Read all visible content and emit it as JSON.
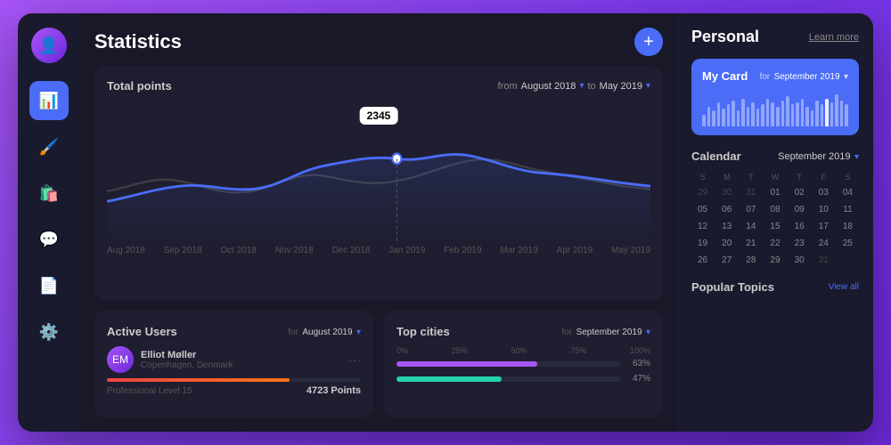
{
  "sidebar": {
    "icons": [
      "📊",
      "🖌️",
      "🛍️",
      "💬",
      "📄",
      "⚙️"
    ]
  },
  "header": {
    "title": "Statistics",
    "add_btn": "+"
  },
  "chart": {
    "title": "Total points",
    "from_label": "from",
    "from_value": "August 2018",
    "to_label": "to",
    "to_value": "May 2019",
    "tooltip_value": "2345",
    "x_labels": [
      "Aug 2018",
      "Sep 2018",
      "Oct 2018",
      "Nov 2018",
      "Dec 2018",
      "Jan 2019",
      "Feb 2019",
      "Mar 2019",
      "Apr 2019",
      "May 2019"
    ]
  },
  "active_users": {
    "title": "Active Users",
    "for_label": "for",
    "for_value": "August 2019",
    "user_name": "Elliot Møller",
    "user_location": "Copenhagen, Denmark",
    "progress_label": "Professional Level 15",
    "progress_points": "4723 Points",
    "progress_percent": 72
  },
  "top_cities": {
    "title": "Top cities",
    "for_label": "for",
    "for_value": "September 2019",
    "x_labels": [
      "0%",
      "25%",
      "50%",
      "75%",
      "100%"
    ],
    "bars": [
      {
        "color": "#a855f7",
        "percent": 63,
        "label": "63%"
      },
      {
        "color": "#22d3a7",
        "percent": 47,
        "label": "47%"
      }
    ]
  },
  "right_panel": {
    "title": "Personal",
    "learn_more": "Learn more",
    "my_card": {
      "title": "My Card",
      "for_label": "for",
      "for_value": "September 2019",
      "bar_heights": [
        30,
        50,
        40,
        60,
        45,
        55,
        65,
        40,
        70,
        50,
        60,
        45,
        55,
        70,
        60,
        50,
        65,
        75,
        55,
        60,
        70,
        50,
        40,
        65,
        55,
        70,
        60,
        80,
        65,
        55
      ]
    },
    "calendar": {
      "title": "Calendar",
      "month": "September 2019",
      "day_headers": [
        "S",
        "M",
        "T",
        "W",
        "T",
        "F",
        "S"
      ],
      "days": [
        {
          "label": "29",
          "type": "other-month"
        },
        {
          "label": "30",
          "type": "other-month"
        },
        {
          "label": "31",
          "type": "other-month"
        },
        {
          "label": "01",
          "type": "normal"
        },
        {
          "label": "02",
          "type": "today"
        },
        {
          "label": "03",
          "type": "normal"
        },
        {
          "label": "04",
          "type": "normal"
        },
        {
          "label": "05",
          "type": "normal"
        },
        {
          "label": "06",
          "type": "normal"
        },
        {
          "label": "07",
          "type": "normal"
        },
        {
          "label": "08",
          "type": "normal"
        },
        {
          "label": "09",
          "type": "normal"
        },
        {
          "label": "10",
          "type": "normal"
        },
        {
          "label": "11",
          "type": "normal"
        },
        {
          "label": "12",
          "type": "normal"
        },
        {
          "label": "13",
          "type": "normal"
        },
        {
          "label": "14",
          "type": "normal"
        },
        {
          "label": "15",
          "type": "normal"
        },
        {
          "label": "16",
          "type": "selected"
        },
        {
          "label": "17",
          "type": "selected2"
        },
        {
          "label": "18",
          "type": "normal"
        },
        {
          "label": "19",
          "type": "normal"
        },
        {
          "label": "20",
          "type": "special"
        },
        {
          "label": "21",
          "type": "normal"
        },
        {
          "label": "22",
          "type": "normal"
        },
        {
          "label": "23",
          "type": "normal"
        },
        {
          "label": "24",
          "type": "normal"
        },
        {
          "label": "25",
          "type": "normal"
        },
        {
          "label": "26",
          "type": "normal"
        },
        {
          "label": "27",
          "type": "normal"
        },
        {
          "label": "28",
          "type": "normal"
        },
        {
          "label": "29",
          "type": "normal"
        },
        {
          "label": "30",
          "type": "normal"
        },
        {
          "label": "31",
          "type": "other-month"
        }
      ]
    },
    "popular_topics": {
      "title": "Popular Topics",
      "view_all": "View all"
    }
  }
}
